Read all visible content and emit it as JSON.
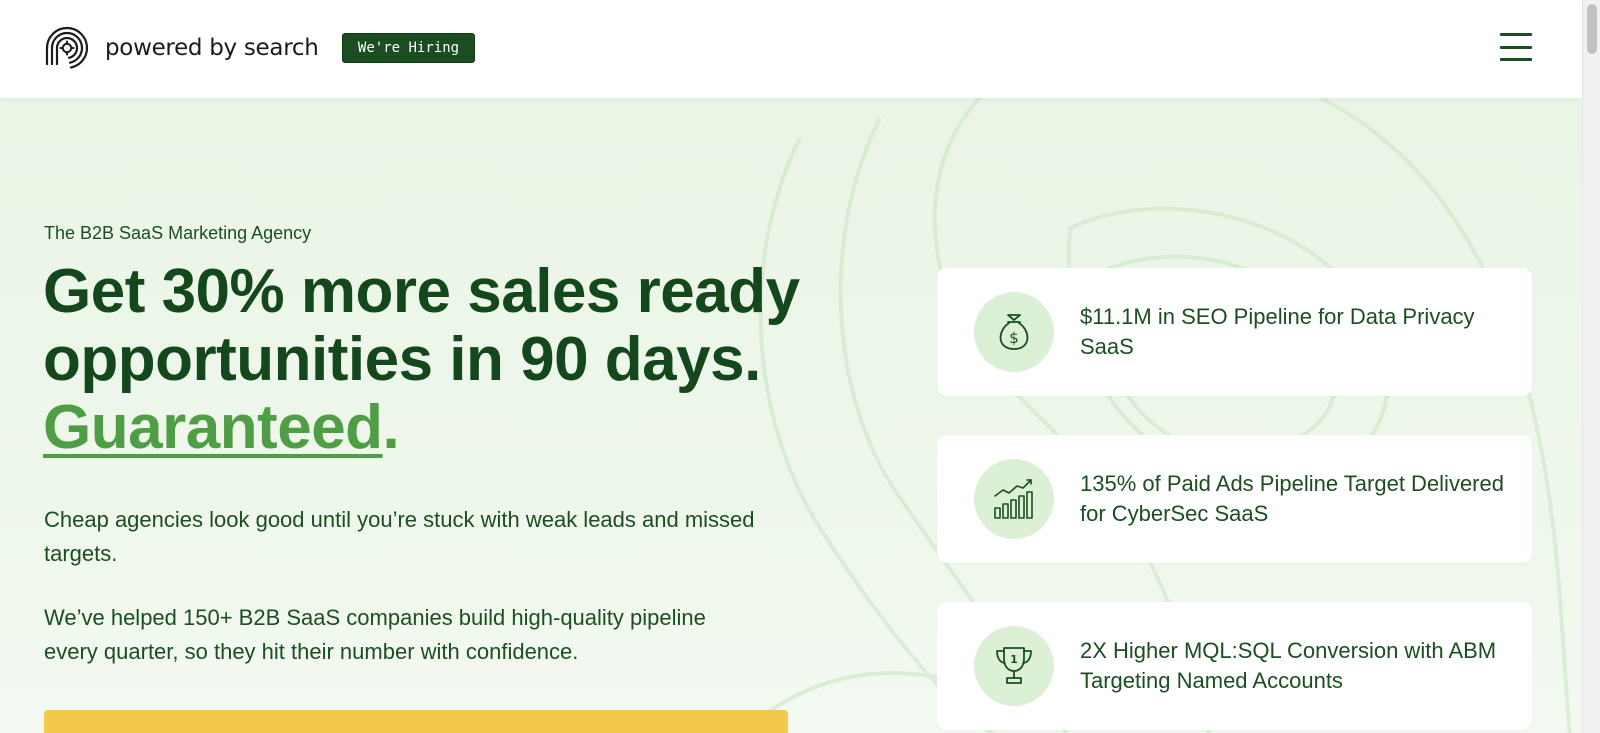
{
  "header": {
    "brand": "powered by search",
    "hiring_badge": "We're Hiring",
    "logo_icon": "fingerprint-gear-logo",
    "menu_icon": "hamburger-menu-icon"
  },
  "hero": {
    "eyebrow": "The B2B SaaS Marketing Agency",
    "headline_part1": "Get 30% more sales ready opportunities in 90 days. ",
    "headline_accent": "Guaranteed",
    "headline_dot": ".",
    "paragraph1": "Cheap agencies look good until you’re stuck with weak leads and missed targets.",
    "paragraph2": "We’ve helped 150+ B2B SaaS companies build high-quality pipeline every quarter, so they hit their number with confidence."
  },
  "stats": [
    {
      "icon": "money-bag-icon",
      "text": "$11.1M in SEO Pipeline for Data Privacy SaaS"
    },
    {
      "icon": "growth-chart-icon",
      "text": "135% of Paid Ads Pipeline Target Delivered for CyberSec SaaS"
    },
    {
      "icon": "trophy-icon",
      "text": "2X Higher MQL:SQL Conversion with ABM Targeting Named Accounts"
    }
  ],
  "colors": {
    "brand_dark_green": "#14471c",
    "accent_green": "#4f9e45",
    "hero_bg": "#eaf5e6",
    "icon_circle": "#dcf0d6",
    "cta_yellow": "#f2c94c"
  }
}
